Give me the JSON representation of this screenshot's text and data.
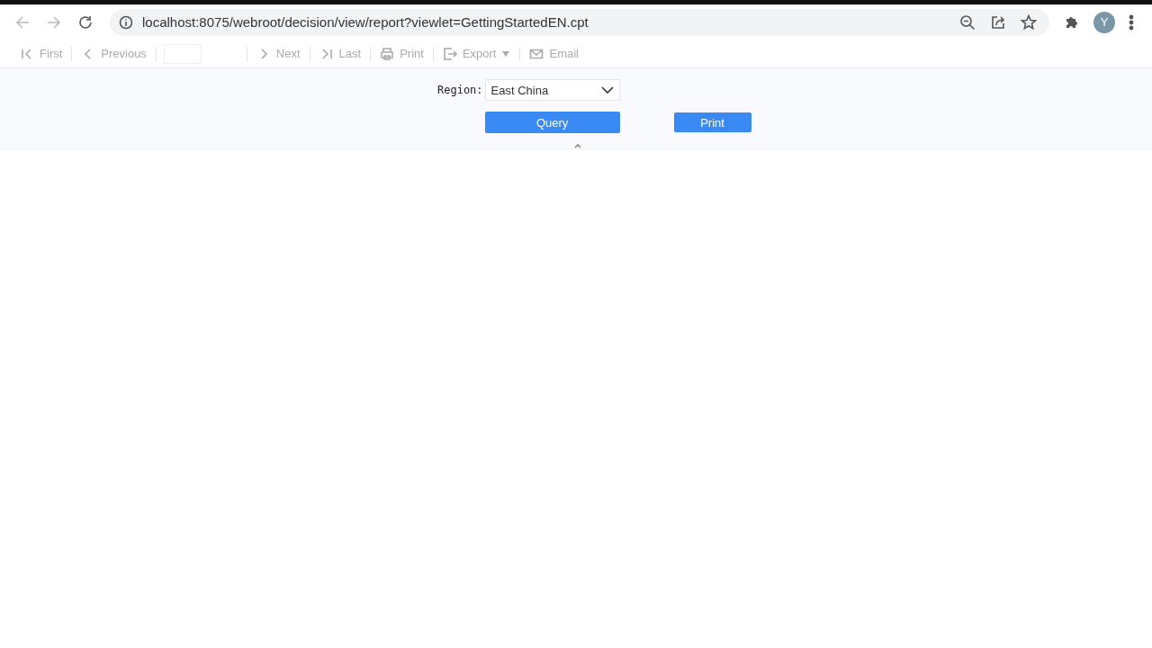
{
  "browser": {
    "url": "localhost:8075/webroot/decision/view/report?viewlet=GettingStartedEN.cpt",
    "avatar": "Y"
  },
  "toolbar": [
    {
      "kind": "first",
      "label": "First",
      "disabled": true
    },
    {
      "kind": "previous",
      "label": "Previous",
      "disabled": true
    },
    {
      "kind": "page",
      "disabled": true
    },
    {
      "kind": "next",
      "label": "Next",
      "disabled": true
    },
    {
      "kind": "last",
      "label": "Last",
      "disabled": true
    },
    {
      "kind": "print",
      "label": "Print",
      "disabled": true
    },
    {
      "kind": "export",
      "label": "Export",
      "disabled": true
    },
    {
      "kind": "email",
      "label": "Email",
      "disabled": true
    }
  ],
  "parameters": {
    "label": "Region:",
    "select": {
      "value": "East China"
    },
    "buttons": [
      {
        "kind": "query",
        "label": "Query"
      },
      {
        "kind": "print",
        "label": "Print"
      }
    ]
  }
}
